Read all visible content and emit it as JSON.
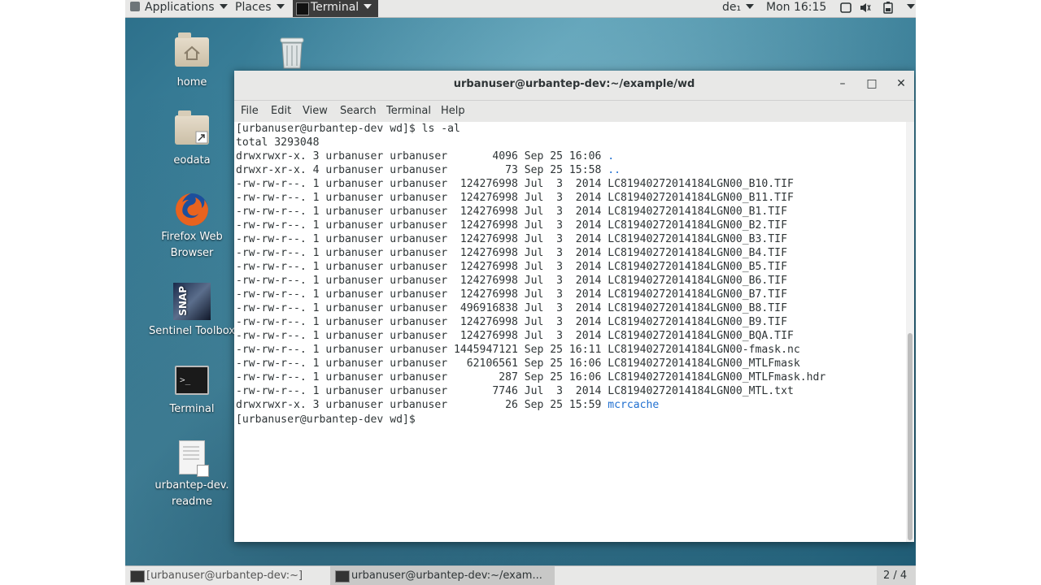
{
  "topbar": {
    "applications": "Applications",
    "places": "Places",
    "terminal": "Terminal",
    "lang": "de₁",
    "clock": "Mon 16:15"
  },
  "desktop_icons": [
    {
      "label": "home",
      "icon": "home-folder-icon"
    },
    {
      "label": "eodata",
      "icon": "folder-link-icon"
    },
    {
      "label": "Firefox Web Browser",
      "icon": "firefox-icon"
    },
    {
      "label": "Sentinel Toolbox",
      "icon": "snap-icon"
    },
    {
      "label": "Terminal",
      "icon": "terminal-icon"
    },
    {
      "label": "urbantep-dev.\nreadme",
      "icon": "document-link-icon"
    },
    {
      "label": "",
      "icon": "trash-icon"
    }
  ],
  "window": {
    "title": "urbanuser@urbantep-dev:~/example/wd",
    "menu": [
      "File",
      "Edit",
      "View",
      "Search",
      "Terminal",
      "Help"
    ]
  },
  "terminal_lines": [
    {
      "text": "[urbanuser@urbantep-dev wd]$ ls -al"
    },
    {
      "text": "total 3293048"
    },
    {
      "text": "drwxrwxr-x. 3 urbanuser urbanuser       4096 Sep 25 16:06 ",
      "link": "."
    },
    {
      "text": "drwxr-xr-x. 4 urbanuser urbanuser         73 Sep 25 15:58 ",
      "link": ".."
    },
    {
      "text": "-rw-rw-r--. 1 urbanuser urbanuser  124276998 Jul  3  2014 LC81940272014184LGN00_B10.TIF"
    },
    {
      "text": "-rw-rw-r--. 1 urbanuser urbanuser  124276998 Jul  3  2014 LC81940272014184LGN00_B11.TIF"
    },
    {
      "text": "-rw-rw-r--. 1 urbanuser urbanuser  124276998 Jul  3  2014 LC81940272014184LGN00_B1.TIF"
    },
    {
      "text": "-rw-rw-r--. 1 urbanuser urbanuser  124276998 Jul  3  2014 LC81940272014184LGN00_B2.TIF"
    },
    {
      "text": "-rw-rw-r--. 1 urbanuser urbanuser  124276998 Jul  3  2014 LC81940272014184LGN00_B3.TIF"
    },
    {
      "text": "-rw-rw-r--. 1 urbanuser urbanuser  124276998 Jul  3  2014 LC81940272014184LGN00_B4.TIF"
    },
    {
      "text": "-rw-rw-r--. 1 urbanuser urbanuser  124276998 Jul  3  2014 LC81940272014184LGN00_B5.TIF"
    },
    {
      "text": "-rw-rw-r--. 1 urbanuser urbanuser  124276998 Jul  3  2014 LC81940272014184LGN00_B6.TIF"
    },
    {
      "text": "-rw-rw-r--. 1 urbanuser urbanuser  124276998 Jul  3  2014 LC81940272014184LGN00_B7.TIF"
    },
    {
      "text": "-rw-rw-r--. 1 urbanuser urbanuser  496916838 Jul  3  2014 LC81940272014184LGN00_B8.TIF"
    },
    {
      "text": "-rw-rw-r--. 1 urbanuser urbanuser  124276998 Jul  3  2014 LC81940272014184LGN00_B9.TIF"
    },
    {
      "text": "-rw-rw-r--. 1 urbanuser urbanuser  124276998 Jul  3  2014 LC81940272014184LGN00_BQA.TIF"
    },
    {
      "text": "-rw-rw-r--. 1 urbanuser urbanuser 1445947121 Sep 25 16:11 LC81940272014184LGN00-fmask.nc"
    },
    {
      "text": "-rw-rw-r--. 1 urbanuser urbanuser   62106561 Sep 25 16:06 LC81940272014184LGN00_MTLFmask"
    },
    {
      "text": "-rw-rw-r--. 1 urbanuser urbanuser        287 Sep 25 16:06 LC81940272014184LGN00_MTLFmask.hdr"
    },
    {
      "text": "-rw-rw-r--. 1 urbanuser urbanuser       7746 Jul  3  2014 LC81940272014184LGN00_MTL.txt"
    },
    {
      "text": "drwxrwxr-x. 3 urbanuser urbanuser         26 Sep 25 15:59 ",
      "link": "mcrcache"
    },
    {
      "text": "[urbanuser@urbantep-dev wd]$ "
    }
  ],
  "taskbar": {
    "tasks": [
      "[urbanuser@urbantep-dev:~]",
      "urbanuser@urbantep-dev:~/exam..."
    ],
    "workspace": "2 / 4"
  },
  "colors": {
    "link": "#1f6fd0",
    "panel": "#e8e8e7"
  }
}
